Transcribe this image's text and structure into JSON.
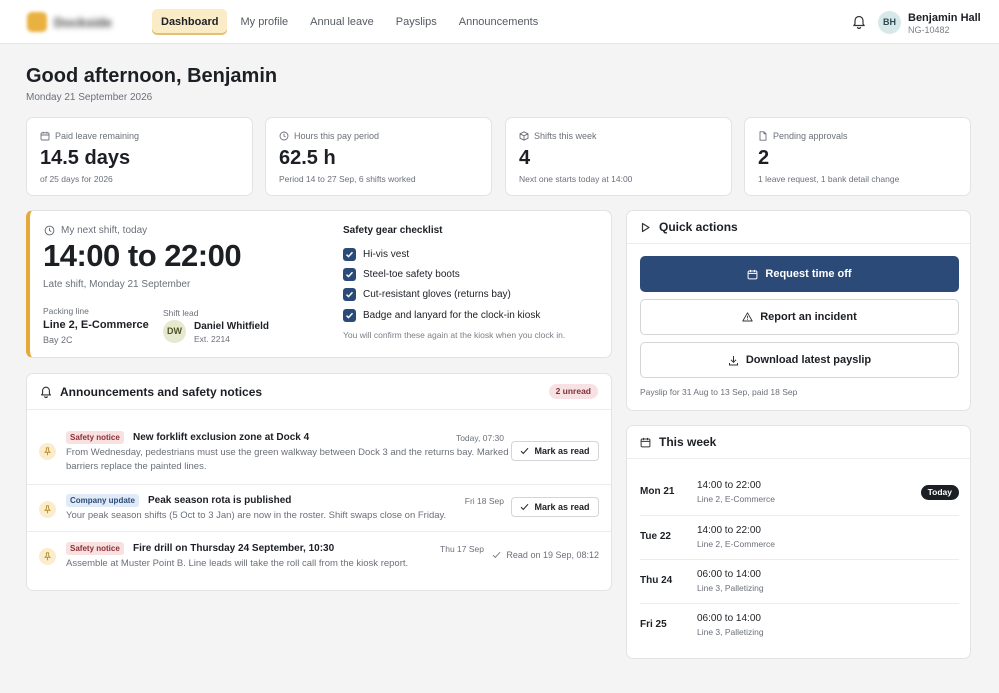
{
  "header": {
    "brand": "Dockside",
    "nav": [
      "Dashboard",
      "My profile",
      "Annual leave",
      "Payslips",
      "Announcements"
    ],
    "active_nav": "Dashboard",
    "user": {
      "initials": "BH",
      "name": "Benjamin Hall",
      "id": "NG-10482"
    }
  },
  "greeting": "Good afternoon, Benjamin",
  "date": "Monday 21 September 2026",
  "stats": [
    {
      "label": "Paid leave remaining",
      "value": "14.5 days",
      "sub": "of 25 days for 2026",
      "icon": "calendar-icon"
    },
    {
      "label": "Hours this pay period",
      "value": "62.5 h",
      "sub": "Period 14 to 27 Sep, 6 shifts worked",
      "icon": "clock-icon"
    },
    {
      "label": "Shifts this week",
      "value": "4",
      "sub": "Next one starts today at 14:00",
      "icon": "box-icon"
    },
    {
      "label": "Pending approvals",
      "value": "2",
      "sub": "1 leave request, 1 bank detail change",
      "icon": "document-icon"
    }
  ],
  "next_shift": {
    "label": "My next shift, today",
    "time": "14:00 to 22:00",
    "sub": "Late shift, Monday 21 September",
    "packing_line_label": "Packing line",
    "packing_line": "Line 2, E-Commerce",
    "bay": "Bay 2C",
    "shift_lead_label": "Shift lead",
    "lead_initials": "DW",
    "lead_name": "Daniel Whitfield",
    "lead_ext": "Ext. 2214",
    "checklist_title": "Safety gear checklist",
    "checklist": [
      "Hi-vis vest",
      "Steel-toe safety boots",
      "Cut-resistant gloves (returns bay)",
      "Badge and lanyard for the clock-in kiosk"
    ],
    "checklist_note": "You will confirm these again at the kiosk when you clock in."
  },
  "announcements": {
    "title": "Announcements and safety notices",
    "unread": "2 unread",
    "items": [
      {
        "tag": "Safety notice",
        "title": "New forklift exclusion zone at Dock 4",
        "time": "Today, 07:30",
        "body": "From Wednesday, pedestrians must use the green walkway between Dock 3 and the returns bay. Marked barriers replace the painted lines.",
        "action": "Mark as read"
      },
      {
        "tag": "Company update",
        "title": "Peak season rota is published",
        "time": "Fri 18 Sep",
        "body": "Your peak season shifts (5 Oct to 3 Jan) are now in the roster. Shift swaps close on Friday.",
        "action": "Mark as read"
      },
      {
        "tag": "Safety notice",
        "title": "Fire drill on Thursday 24 September, 10:30",
        "time": "Thu 17 Sep",
        "body": "Assemble at Muster Point B. Line leads will take the roll call from the kiosk report.",
        "read_note": "Read on 19 Sep, 08:12"
      }
    ]
  },
  "quick_actions": {
    "title": "Quick actions",
    "request_time_off": "Request time off",
    "report_incident": "Report an incident",
    "download_payslip": "Download latest payslip",
    "payslip_note": "Payslip for 31 Aug to 13 Sep, paid 18 Sep"
  },
  "this_week": {
    "title": "This week",
    "today_badge": "Today",
    "days": [
      {
        "day": "Mon 21",
        "time": "14:00 to 22:00",
        "line": "Line 2, E-Commerce"
      },
      {
        "day": "Tue 22",
        "time": "14:00 to 22:00",
        "line": "Line 2, E-Commerce"
      },
      {
        "day": "Thu 24",
        "time": "06:00 to 14:00",
        "line": "Line 3, Palletizing"
      },
      {
        "day": "Fri 25",
        "time": "06:00 to 14:00",
        "line": "Line 3, Palletizing"
      }
    ]
  },
  "colors": {
    "accent": "#2c4a78",
    "highlight": "#e7a93a",
    "nav_active": "#fbecc8"
  }
}
